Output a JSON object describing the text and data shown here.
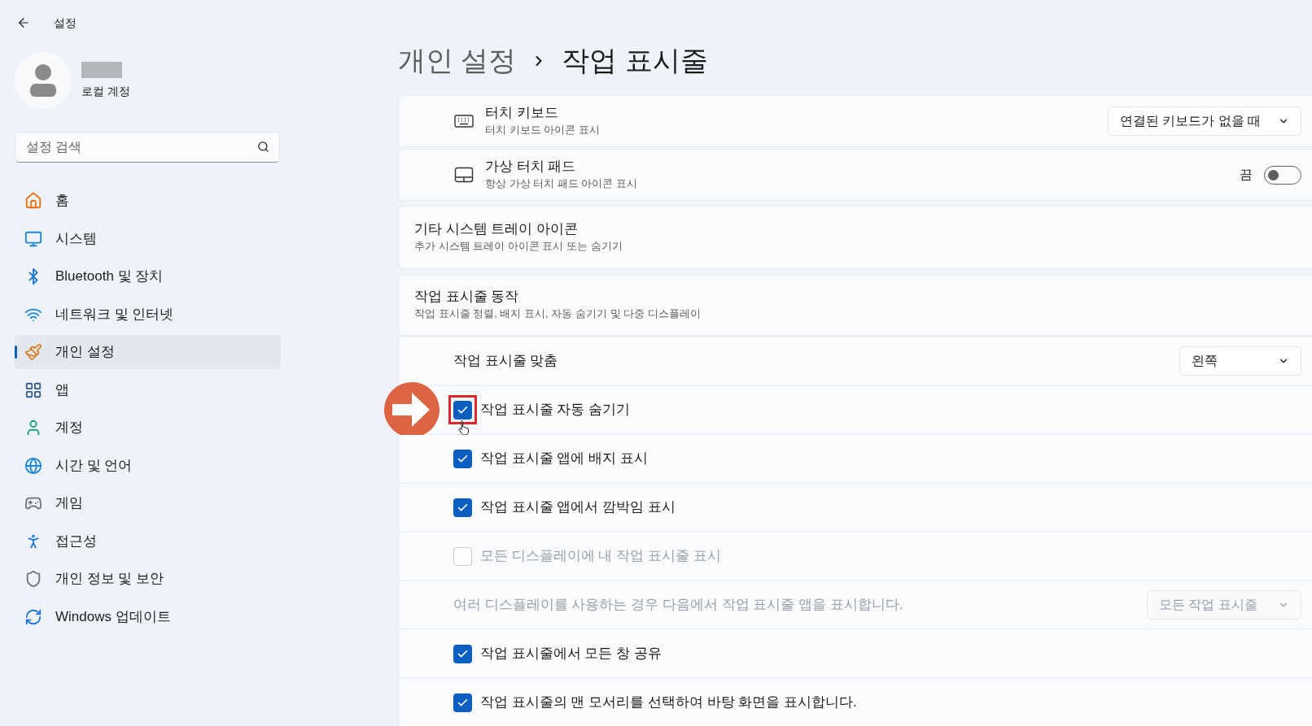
{
  "window": {
    "title": "설정"
  },
  "account": {
    "type": "로컬 계정"
  },
  "search": {
    "placeholder": "설정 검색"
  },
  "nav": {
    "items": [
      {
        "label": "홈",
        "selected": false
      },
      {
        "label": "시스템",
        "selected": false
      },
      {
        "label": "Bluetooth 및 장치",
        "selected": false
      },
      {
        "label": "네트워크 및 인터넷",
        "selected": false
      },
      {
        "label": "개인 설정",
        "selected": true
      },
      {
        "label": "앱",
        "selected": false
      },
      {
        "label": "계정",
        "selected": false
      },
      {
        "label": "시간 및 언어",
        "selected": false
      },
      {
        "label": "게임",
        "selected": false
      },
      {
        "label": "접근성",
        "selected": false
      },
      {
        "label": "개인 정보 및 보안",
        "selected": false
      },
      {
        "label": "Windows 업데이트",
        "selected": false
      }
    ]
  },
  "breadcrumb": [
    "개인 설정",
    "작업 표시줄"
  ],
  "tray_icons": [
    {
      "kind": "dropdown",
      "title": "터치 키보드",
      "subtitle": "터치 키보드 아이콘 표시",
      "value": "연결된 키보드가 없을 때"
    },
    {
      "kind": "toggle",
      "title": "가상 터치 패드",
      "subtitle": "항상 가상 터치 패드 아이콘 표시",
      "state_label": "끔",
      "on": false
    }
  ],
  "other_tray": {
    "title": "기타 시스템 트레이 아이콘",
    "subtitle": "추가 시스템 트레이 아이콘 표시 또는 숨기기"
  },
  "behaviors": {
    "title": "작업 표시줄 동작",
    "subtitle": "작업 표시줄 정렬, 배지 표시, 자동 숨기기 및 다중 디스플레이",
    "rows": [
      {
        "kind": "dropdown",
        "label": "작업 표시줄 맞춤",
        "value": "왼쪽",
        "disabled": false
      },
      {
        "kind": "checkbox",
        "label": "작업 표시줄 자동 숨기기",
        "checked": true,
        "disabled": false,
        "highlighted": true
      },
      {
        "kind": "checkbox",
        "label": "작업 표시줄 앱에 배지 표시",
        "checked": true,
        "disabled": false,
        "highlighted": false
      },
      {
        "kind": "checkbox",
        "label": "작업 표시줄 앱에서 깜박임 표시",
        "checked": true,
        "disabled": false,
        "highlighted": false
      },
      {
        "kind": "checkbox",
        "label": "모든 디스플레이에 내 작업 표시줄 표시",
        "checked": false,
        "disabled": true,
        "highlighted": false
      },
      {
        "kind": "dropdown",
        "label": "여러 디스플레이를 사용하는 경우 다음에서 작업 표시줄 앱을 표시합니다.",
        "value": "모든 작업 표시줄",
        "disabled": true
      },
      {
        "kind": "checkbox",
        "label": "작업 표시줄에서 모든 창 공유",
        "checked": true,
        "disabled": false,
        "highlighted": false
      },
      {
        "kind": "checkbox",
        "label": "작업 표시줄의 맨 모서리를 선택하여 바탕 화면을 표시합니다.",
        "checked": true,
        "disabled": false,
        "highlighted": false
      }
    ]
  }
}
